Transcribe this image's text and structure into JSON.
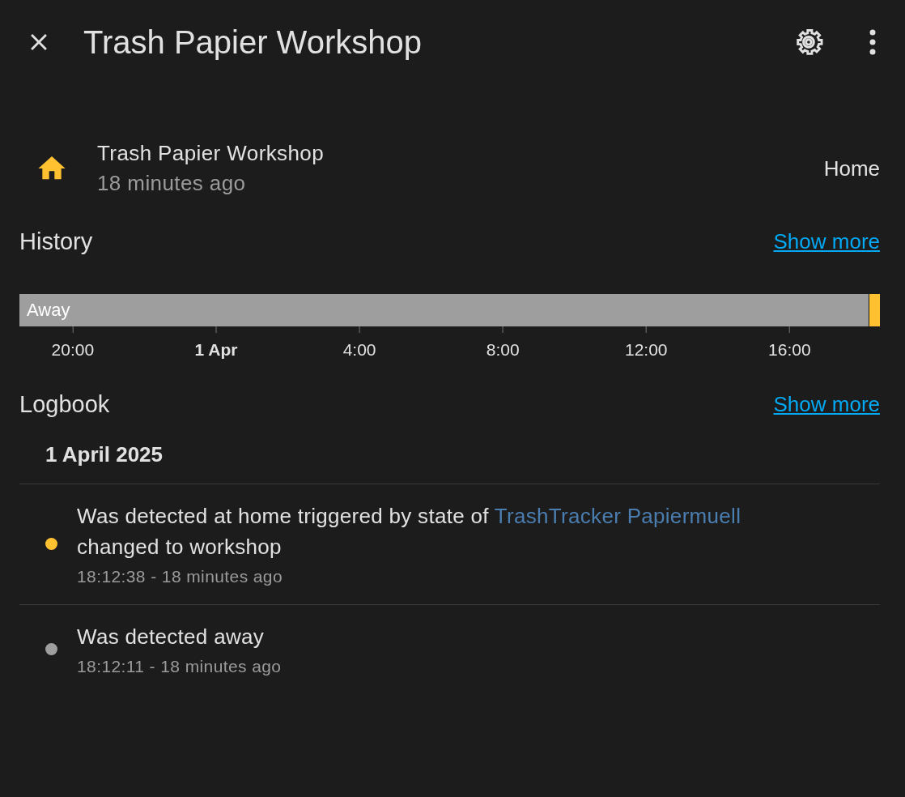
{
  "header": {
    "title": "Trash Papier Workshop"
  },
  "entity": {
    "name": "Trash Papier Workshop",
    "last_changed": "18 minutes ago",
    "state": "Home"
  },
  "history": {
    "title": "History",
    "show_more": "Show more",
    "segments": [
      {
        "label": "Away",
        "color": "#9e9e9e"
      },
      {
        "color": "#ffc130"
      }
    ],
    "ticks": [
      {
        "label": "20:00",
        "kind": "time"
      },
      {
        "label": "1 Apr",
        "kind": "date"
      },
      {
        "label": "4:00",
        "kind": "time"
      },
      {
        "label": "8:00",
        "kind": "time"
      },
      {
        "label": "12:00",
        "kind": "time"
      },
      {
        "label": "16:00",
        "kind": "time"
      }
    ]
  },
  "logbook": {
    "title": "Logbook",
    "show_more": "Show more",
    "date": "1 April 2025",
    "entries": [
      {
        "color": "#ffc130",
        "text": "Was detected at home triggered by state of",
        "link": "TrashTracker Papiermuell",
        "text_after": "changed to workshop",
        "time": "18:12:38 - 18 minutes ago"
      },
      {
        "color": "#9e9e9e",
        "text": "Was detected away",
        "time": "18:12:11 - 18 minutes ago"
      }
    ]
  }
}
